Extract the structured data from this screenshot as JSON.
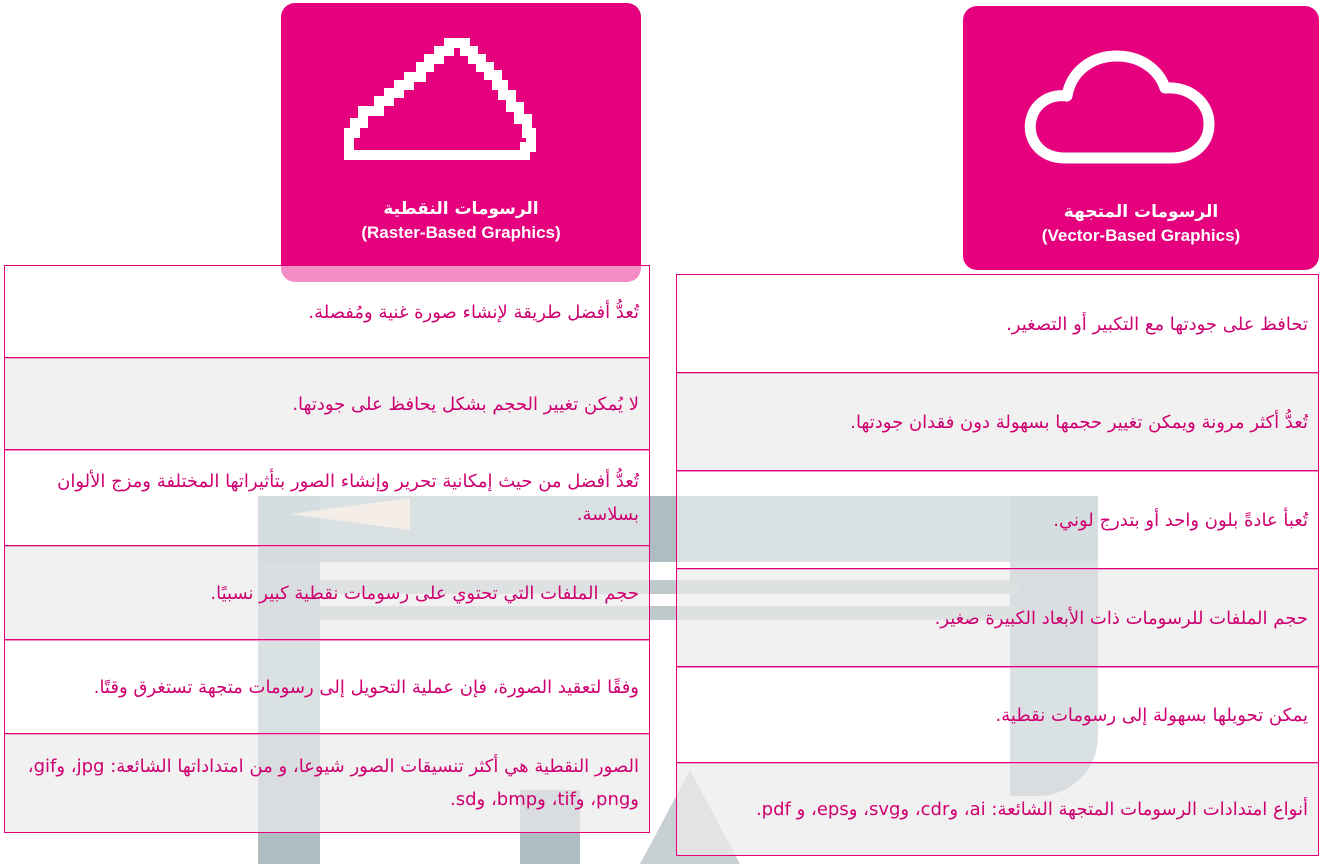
{
  "vector": {
    "title_ar": "الرسومات المتجهة",
    "title_en": "(Vector-Based Graphics)",
    "icon": "cloud-smooth-icon",
    "rows": [
      "تحافظ على جودتها مع التكبير أو التصغير.",
      "تُعدُّ أكثر مرونة ويمكن تغيير حجمها بسهولة دون فقدان جودتها.",
      "تُعبأ عادةً بلون واحد أو بتدرج لوني.",
      "حجم الملفات للرسومات ذات الأبعاد الكبيرة صغير.",
      "يمكن تحويلها بسهولة إلى رسومات نقطية.",
      "أنواع امتدادات الرسومات المتجهة الشائعة: ai، وcdr، وsvg، وeps، و pdf."
    ]
  },
  "raster": {
    "title_ar": "الرسومات النقطية",
    "title_en": "(Raster-Based Graphics)",
    "icon": "cloud-pixelated-icon",
    "rows": [
      "تُعدُّ أفضل طريقة لإنشاء صورة غنية ومُفصلة.",
      "لا يُمكن تغيير الحجم بشكل يحافظ على جودتها.",
      "تُعدُّ أفضل من حيث إمكانية تحرير وإنشاء الصور بتأثيراتها المختلفة ومزج الألوان بسلاسة.",
      "حجم الملفات التي تحتوي على رسومات نقطية كبير نسبيًا.",
      "وفقًا لتعقيد الصورة، فإن عملية التحويل إلى رسومات متجهة تستغرق وقتًا.",
      "الصور النقطية هي أكثر تنسيقات الصور شيوعا، و من امتداداتها الشائعة: jpg، وgif، وpng، وtif، وbmp، وsd."
    ]
  },
  "colors": {
    "accent": "#e6007e",
    "text": "#cf0070"
  }
}
